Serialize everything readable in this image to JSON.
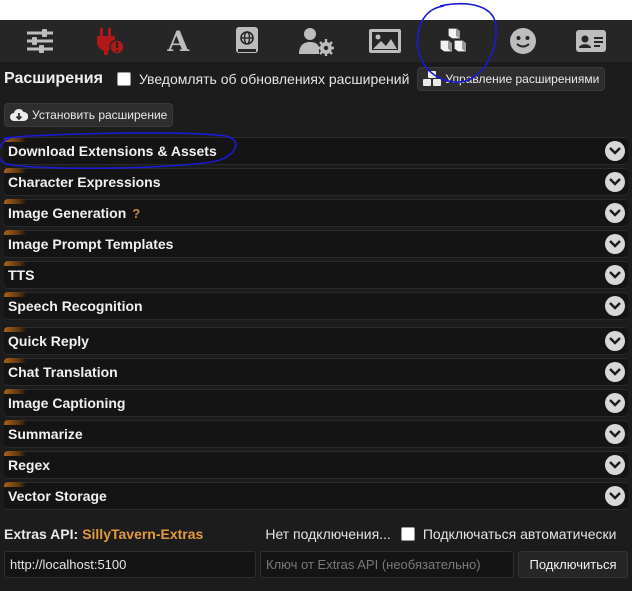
{
  "toolbar": {
    "icons": [
      {
        "name": "sliders-icon"
      },
      {
        "name": "plug-warning-icon"
      },
      {
        "name": "font-a-icon",
        "glyph": "A"
      },
      {
        "name": "book-globe-icon"
      },
      {
        "name": "user-cog-icon"
      },
      {
        "name": "image-icon"
      },
      {
        "name": "cubes-icon"
      },
      {
        "name": "smiley-icon"
      },
      {
        "name": "id-card-icon"
      }
    ]
  },
  "header": {
    "title": "Расширения",
    "notify_label": "Уведомлять об обновлениях расширений",
    "manage_label": "Управление расширениями",
    "install_label": "Установить расширение"
  },
  "drawers": [
    {
      "label": "Download Extensions & Assets"
    },
    {
      "label": "Character Expressions"
    },
    {
      "label": "Image Generation",
      "help": "?"
    },
    {
      "label": "Image Prompt Templates"
    },
    {
      "label": "TTS"
    },
    {
      "label": "Speech Recognition"
    },
    {
      "label": "Quick Reply"
    },
    {
      "label": "Chat Translation"
    },
    {
      "label": "Image Captioning"
    },
    {
      "label": "Summarize"
    },
    {
      "label": "Regex"
    },
    {
      "label": "Vector Storage"
    }
  ],
  "extras": {
    "api_label": "Extras API:",
    "link_label": "SillyTavern-Extras",
    "status": "Нет подключения...",
    "auto_connect_label": "Подключаться автоматически",
    "url_value": "http://localhost:5100",
    "key_placeholder": "Ключ от Extras API (необязательно)",
    "connect_label": "Подключиться"
  },
  "colors": {
    "toolbar_bg": "#262626",
    "panel_bg": "#1c1c1c",
    "drawer_bg": "#141414",
    "accent_orange": "#e09b3d",
    "annotation_blue": "#1a1ad6"
  }
}
